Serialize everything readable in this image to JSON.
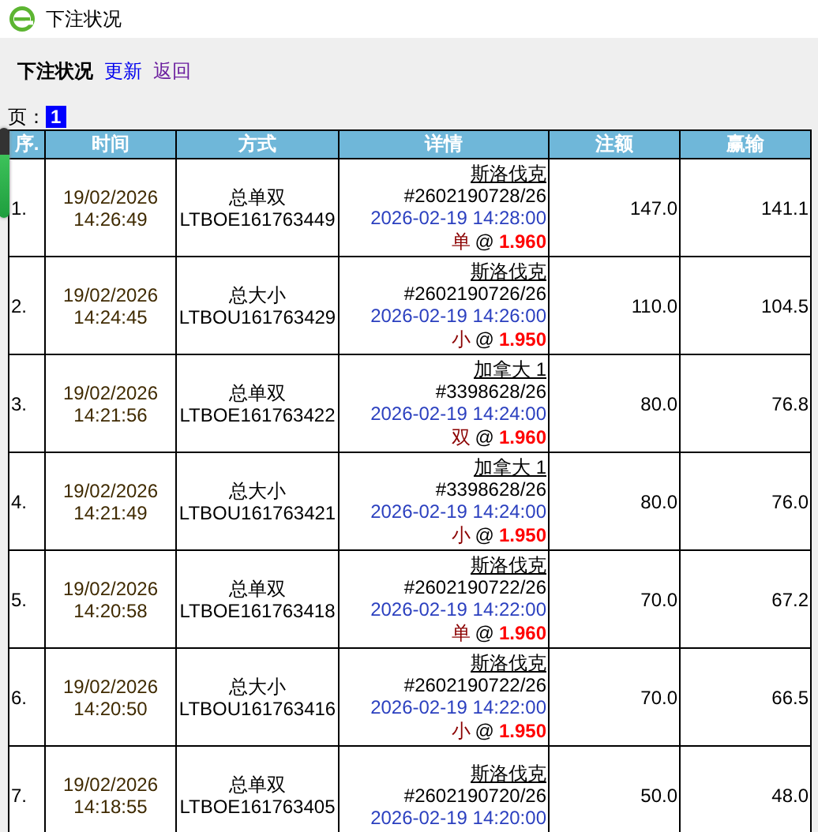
{
  "window": {
    "title": "下注状况"
  },
  "heading": "下注状况",
  "links": [
    {
      "label": "更新",
      "visited": false
    },
    {
      "label": "返回",
      "visited": true
    }
  ],
  "pager": {
    "label": "页：",
    "pages": [
      {
        "label": "1",
        "selected": true
      }
    ]
  },
  "table": {
    "columns": [
      "序.",
      "时间",
      "方式",
      "详情",
      "注额",
      "赢输"
    ],
    "rows": [
      {
        "index": "1.",
        "date": "19/02/2026",
        "time": "14:26:49",
        "method": "总单双",
        "code": "LTBOE161763449",
        "team": "斯洛伐克",
        "match": "#2602190728/26",
        "start": "2026-02-19 14:28:00",
        "pick": "单",
        "at": "@",
        "odds": "1.960",
        "stake": "147.0",
        "result": "141.1"
      },
      {
        "index": "2.",
        "date": "19/02/2026",
        "time": "14:24:45",
        "method": "总大小",
        "code": "LTBOU161763429",
        "team": "斯洛伐克",
        "match": "#2602190726/26",
        "start": "2026-02-19 14:26:00",
        "pick": "小",
        "at": "@",
        "odds": "1.950",
        "stake": "110.0",
        "result": "104.5"
      },
      {
        "index": "3.",
        "date": "19/02/2026",
        "time": "14:21:56",
        "method": "总单双",
        "code": "LTBOE161763422",
        "team": "加拿大 1",
        "match": "#3398628/26",
        "start": "2026-02-19 14:24:00",
        "pick": "双",
        "at": "@",
        "odds": "1.960",
        "stake": "80.0",
        "result": "76.8"
      },
      {
        "index": "4.",
        "date": "19/02/2026",
        "time": "14:21:49",
        "method": "总大小",
        "code": "LTBOU161763421",
        "team": "加拿大 1",
        "match": "#3398628/26",
        "start": "2026-02-19 14:24:00",
        "pick": "小",
        "at": "@",
        "odds": "1.950",
        "stake": "80.0",
        "result": "76.0"
      },
      {
        "index": "5.",
        "date": "19/02/2026",
        "time": "14:20:58",
        "method": "总单双",
        "code": "LTBOE161763418",
        "team": "斯洛伐克",
        "match": "#2602190722/26",
        "start": "2026-02-19 14:22:00",
        "pick": "单",
        "at": "@",
        "odds": "1.960",
        "stake": "70.0",
        "result": "67.2"
      },
      {
        "index": "6.",
        "date": "19/02/2026",
        "time": "14:20:50",
        "method": "总大小",
        "code": "LTBOU161763416",
        "team": "斯洛伐克",
        "match": "#2602190722/26",
        "start": "2026-02-19 14:22:00",
        "pick": "小",
        "at": "@",
        "odds": "1.950",
        "stake": "70.0",
        "result": "66.5"
      },
      {
        "index": "7.",
        "date": "19/02/2026",
        "time": "14:18:55",
        "method": "总单双",
        "code": "LTBOE161763405",
        "team": "斯洛伐克",
        "match": "#2602190720/26",
        "start": "2026-02-19 14:20:00",
        "stake": "50.0",
        "result": "48.0"
      }
    ]
  }
}
